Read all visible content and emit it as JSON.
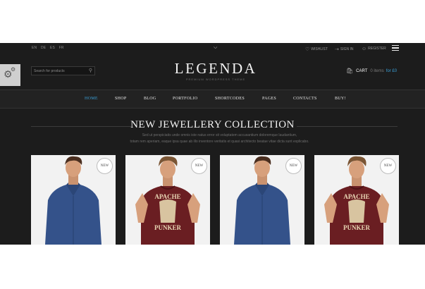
{
  "topbar": {
    "languages": [
      "EN",
      "DE",
      "ES",
      "FR"
    ],
    "wishlist": "WISHLIST",
    "sign_in": "SIGN IN",
    "register": "REGISTER"
  },
  "search": {
    "placeholder": "Search for products"
  },
  "brand": {
    "logo": "LEGENDA",
    "tagline": "PREMIUM WORDPRESS THEME"
  },
  "cart": {
    "label": "CART",
    "items": "0 items",
    "total": "for £0"
  },
  "nav": [
    "HOME",
    "SHOP",
    "BLOG",
    "PORTFOLIO",
    "SHORTCODES",
    "PAGES",
    "CONTACTS",
    "BUY!"
  ],
  "collection": {
    "title": "NEW JEWELLERY COLLECTION",
    "line1": "Sed ut perspiciatis unde omnis iste natus error sit voluptatem accusantium doloremque laudantium,",
    "line2": "totam rem aperiam, eaque ipsa quae ab illo inventore veritatis et quasi architecto beatae vitae dicta sunt explicabo."
  },
  "products": [
    {
      "badge": "NEW",
      "shirt": "denim"
    },
    {
      "badge": "NEW",
      "shirt": "maroon-apache"
    },
    {
      "badge": "NEW",
      "shirt": "denim"
    },
    {
      "badge": "NEW",
      "shirt": "maroon-apache"
    }
  ],
  "shirt_print": {
    "top": "APACHE",
    "bottom": "PUNKER"
  },
  "colors": {
    "accent": "#3aa0d8",
    "background": "#1c1c1c",
    "denim": "#34528a",
    "maroon": "#6a1e22"
  }
}
